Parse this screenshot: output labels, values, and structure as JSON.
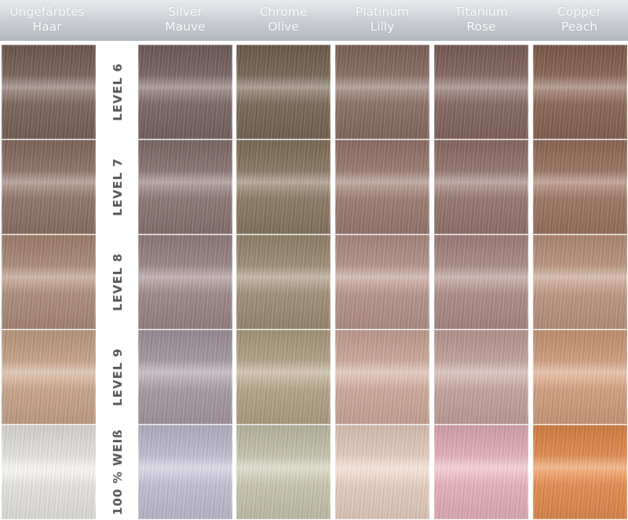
{
  "columns": [
    {
      "id": "ungefaerbt",
      "line1": "Ungefärbtes",
      "line2": "Haar"
    },
    {
      "id": "silver-mauve",
      "line1": "Silver",
      "line2": "Mauve"
    },
    {
      "id": "chrome-olive",
      "line1": "Chrome",
      "line2": "Olive"
    },
    {
      "id": "platinum-lilly",
      "line1": "Platinum",
      "line2": "Lilly"
    },
    {
      "id": "titanium-rose",
      "line1": "Titanium",
      "line2": "Rose"
    },
    {
      "id": "copper-peach",
      "line1": "Copper",
      "line2": "Peach"
    }
  ],
  "rows": [
    {
      "label": "LEVEL 6",
      "colors": [
        "#7b6359",
        "#7a6664",
        "#786755",
        "#8a6d63",
        "#856660",
        "#8a6554"
      ]
    },
    {
      "label": "LEVEL 7",
      "colors": [
        "#8f7266",
        "#8b7572",
        "#8a7862",
        "#9b7b70",
        "#95766e",
        "#9b7461"
      ]
    },
    {
      "label": "LEVEL 8",
      "colors": [
        "#ad8c78",
        "#9c8787",
        "#a08e76",
        "#b6948a",
        "#ac8c86",
        "#bc9680"
      ]
    },
    {
      "label": "LEVEL 9",
      "colors": [
        "#c9a58a",
        "#a89aa3",
        "#b4a488",
        "#cfaa9b",
        "#c5a39d",
        "#d29f7f"
      ]
    },
    {
      "label": "100 % WEIß",
      "colors": [
        "#e8e6e2",
        "#c3bfd2",
        "#c8c6ae",
        "#e8cfc1",
        "#e6b2bb",
        "#e48d4f"
      ]
    }
  ]
}
